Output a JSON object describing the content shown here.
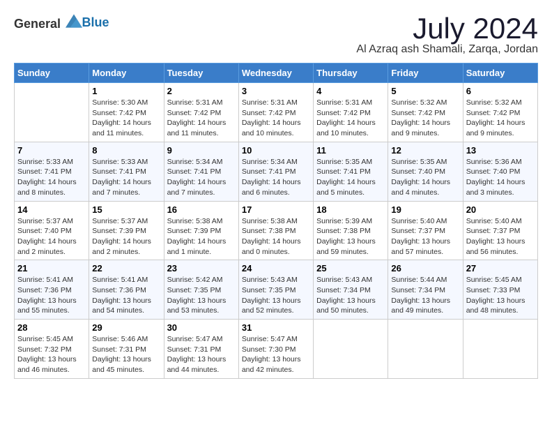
{
  "logo": {
    "text_general": "General",
    "text_blue": "Blue"
  },
  "header": {
    "month": "July 2024",
    "location": "Al Azraq ash Shamali, Zarqa, Jordan"
  },
  "weekdays": [
    "Sunday",
    "Monday",
    "Tuesday",
    "Wednesday",
    "Thursday",
    "Friday",
    "Saturday"
  ],
  "weeks": [
    [
      {
        "day": null
      },
      {
        "day": 1,
        "sunrise": "5:30 AM",
        "sunset": "7:42 PM",
        "daylight": "14 hours and 11 minutes."
      },
      {
        "day": 2,
        "sunrise": "5:31 AM",
        "sunset": "7:42 PM",
        "daylight": "14 hours and 11 minutes."
      },
      {
        "day": 3,
        "sunrise": "5:31 AM",
        "sunset": "7:42 PM",
        "daylight": "14 hours and 10 minutes."
      },
      {
        "day": 4,
        "sunrise": "5:31 AM",
        "sunset": "7:42 PM",
        "daylight": "14 hours and 10 minutes."
      },
      {
        "day": 5,
        "sunrise": "5:32 AM",
        "sunset": "7:42 PM",
        "daylight": "14 hours and 9 minutes."
      },
      {
        "day": 6,
        "sunrise": "5:32 AM",
        "sunset": "7:42 PM",
        "daylight": "14 hours and 9 minutes."
      }
    ],
    [
      {
        "day": 7,
        "sunrise": "5:33 AM",
        "sunset": "7:41 PM",
        "daylight": "14 hours and 8 minutes."
      },
      {
        "day": 8,
        "sunrise": "5:33 AM",
        "sunset": "7:41 PM",
        "daylight": "14 hours and 7 minutes."
      },
      {
        "day": 9,
        "sunrise": "5:34 AM",
        "sunset": "7:41 PM",
        "daylight": "14 hours and 7 minutes."
      },
      {
        "day": 10,
        "sunrise": "5:34 AM",
        "sunset": "7:41 PM",
        "daylight": "14 hours and 6 minutes."
      },
      {
        "day": 11,
        "sunrise": "5:35 AM",
        "sunset": "7:41 PM",
        "daylight": "14 hours and 5 minutes."
      },
      {
        "day": 12,
        "sunrise": "5:35 AM",
        "sunset": "7:40 PM",
        "daylight": "14 hours and 4 minutes."
      },
      {
        "day": 13,
        "sunrise": "5:36 AM",
        "sunset": "7:40 PM",
        "daylight": "14 hours and 3 minutes."
      }
    ],
    [
      {
        "day": 14,
        "sunrise": "5:37 AM",
        "sunset": "7:40 PM",
        "daylight": "14 hours and 2 minutes."
      },
      {
        "day": 15,
        "sunrise": "5:37 AM",
        "sunset": "7:39 PM",
        "daylight": "14 hours and 2 minutes."
      },
      {
        "day": 16,
        "sunrise": "5:38 AM",
        "sunset": "7:39 PM",
        "daylight": "14 hours and 1 minute."
      },
      {
        "day": 17,
        "sunrise": "5:38 AM",
        "sunset": "7:38 PM",
        "daylight": "14 hours and 0 minutes."
      },
      {
        "day": 18,
        "sunrise": "5:39 AM",
        "sunset": "7:38 PM",
        "daylight": "13 hours and 59 minutes."
      },
      {
        "day": 19,
        "sunrise": "5:40 AM",
        "sunset": "7:37 PM",
        "daylight": "13 hours and 57 minutes."
      },
      {
        "day": 20,
        "sunrise": "5:40 AM",
        "sunset": "7:37 PM",
        "daylight": "13 hours and 56 minutes."
      }
    ],
    [
      {
        "day": 21,
        "sunrise": "5:41 AM",
        "sunset": "7:36 PM",
        "daylight": "13 hours and 55 minutes."
      },
      {
        "day": 22,
        "sunrise": "5:41 AM",
        "sunset": "7:36 PM",
        "daylight": "13 hours and 54 minutes."
      },
      {
        "day": 23,
        "sunrise": "5:42 AM",
        "sunset": "7:35 PM",
        "daylight": "13 hours and 53 minutes."
      },
      {
        "day": 24,
        "sunrise": "5:43 AM",
        "sunset": "7:35 PM",
        "daylight": "13 hours and 52 minutes."
      },
      {
        "day": 25,
        "sunrise": "5:43 AM",
        "sunset": "7:34 PM",
        "daylight": "13 hours and 50 minutes."
      },
      {
        "day": 26,
        "sunrise": "5:44 AM",
        "sunset": "7:34 PM",
        "daylight": "13 hours and 49 minutes."
      },
      {
        "day": 27,
        "sunrise": "5:45 AM",
        "sunset": "7:33 PM",
        "daylight": "13 hours and 48 minutes."
      }
    ],
    [
      {
        "day": 28,
        "sunrise": "5:45 AM",
        "sunset": "7:32 PM",
        "daylight": "13 hours and 46 minutes."
      },
      {
        "day": 29,
        "sunrise": "5:46 AM",
        "sunset": "7:31 PM",
        "daylight": "13 hours and 45 minutes."
      },
      {
        "day": 30,
        "sunrise": "5:47 AM",
        "sunset": "7:31 PM",
        "daylight": "13 hours and 44 minutes."
      },
      {
        "day": 31,
        "sunrise": "5:47 AM",
        "sunset": "7:30 PM",
        "daylight": "13 hours and 42 minutes."
      },
      {
        "day": null
      },
      {
        "day": null
      },
      {
        "day": null
      }
    ]
  ],
  "labels": {
    "sunrise": "Sunrise:",
    "sunset": "Sunset:",
    "daylight": "Daylight:"
  }
}
